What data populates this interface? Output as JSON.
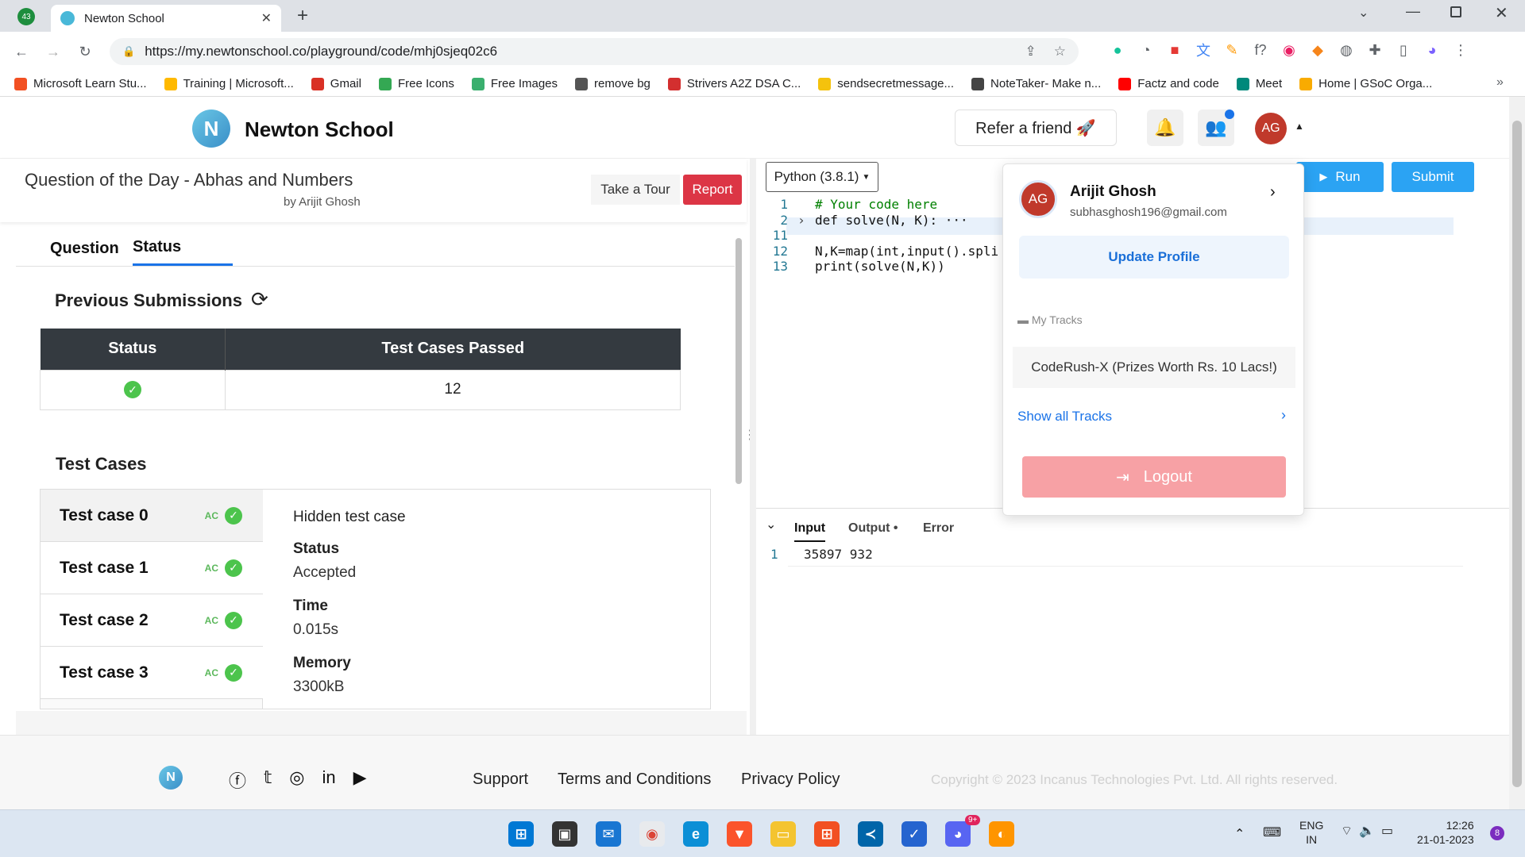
{
  "browser": {
    "tab_count_badge": "43",
    "tab_title": "Newton School",
    "url": "https://my.newtonschool.co/playground/code/mhj0sjeq02c6",
    "bookmarks": [
      {
        "label": "Microsoft Learn Stu...",
        "color": "#f25022"
      },
      {
        "label": "Training | Microsoft...",
        "color": "#ffb900"
      },
      {
        "label": "Gmail",
        "color": "#d93025"
      },
      {
        "label": "Free Icons",
        "color": "#34a853"
      },
      {
        "label": "Free Images",
        "color": "#3aaf6e"
      },
      {
        "label": "remove bg",
        "color": "#555555"
      },
      {
        "label": "Strivers A2Z DSA C...",
        "color": "#d32f2f"
      },
      {
        "label": "sendsecretmessage...",
        "color": "#f4c20d"
      },
      {
        "label": "NoteTaker- Make n...",
        "color": "#444444"
      },
      {
        "label": "Factz and code",
        "color": "#ff0000"
      },
      {
        "label": "Meet",
        "color": "#00897b"
      },
      {
        "label": "Home | GSoC Orga...",
        "color": "#f9ab00"
      }
    ],
    "more_bookmarks": "»"
  },
  "site": {
    "brand": "Newton School",
    "refer_label": "Refer a friend 🚀",
    "avatar_initials": "AG"
  },
  "question": {
    "title": "Question of the Day - Abhas and Numbers",
    "author": "by Arijit Ghosh",
    "take_tour": "Take a Tour",
    "report": "Report",
    "tabs": [
      "Question",
      "Status"
    ],
    "active_tab": "Status"
  },
  "submissions": {
    "heading": "Previous Submissions",
    "columns": [
      "Status",
      "Test Cases Passed"
    ],
    "rows": [
      {
        "status": "✓",
        "passed": "12"
      }
    ]
  },
  "test_cases": {
    "heading": "Test Cases",
    "items": [
      {
        "label": "Test case 0",
        "verdict": "AC"
      },
      {
        "label": "Test case 1",
        "verdict": "AC"
      },
      {
        "label": "Test case 2",
        "verdict": "AC"
      },
      {
        "label": "Test case 3",
        "verdict": "AC"
      }
    ],
    "detail": {
      "title": "Hidden test case",
      "status_label": "Status",
      "status_value": "Accepted",
      "time_label": "Time",
      "time_value": "0.015s",
      "memory_label": "Memory",
      "memory_value": "3300kB"
    }
  },
  "editor": {
    "language": "Python (3.8.1)",
    "run": "Run",
    "submit": "Submit",
    "lines": [
      {
        "no": "1",
        "text": "# Your code here"
      },
      {
        "no": "2",
        "text": "def solve(N, K): ···"
      },
      {
        "no": "11",
        "text": ""
      },
      {
        "no": "12",
        "text": "N,K=map(int,input().spli"
      },
      {
        "no": "13",
        "text": "print(solve(N,K))"
      }
    ],
    "io_tabs": [
      "Input",
      "Output •",
      "Error"
    ],
    "input_line_no": "1",
    "input_value": "35897 932"
  },
  "profile_menu": {
    "name": "Arijit Ghosh",
    "email": "subhasghosh196@gmail.com",
    "update_profile": "Update Profile",
    "my_tracks": "My Tracks",
    "track": "CodeRush-X (Prizes Worth Rs. 10 Lacs!)",
    "show_all": "Show all Tracks",
    "logout": "Logout"
  },
  "footer": {
    "links": [
      "Support",
      "Terms and Conditions",
      "Privacy Policy"
    ],
    "copyright": "Copyright © 2023 Incanus Technologies Pvt. Ltd. All rights reserved."
  },
  "taskbar": {
    "lang_top": "ENG",
    "lang_bottom": "IN",
    "time": "12:26",
    "date": "21-01-2023",
    "notification_count": "8",
    "discord_badge": "9+"
  }
}
